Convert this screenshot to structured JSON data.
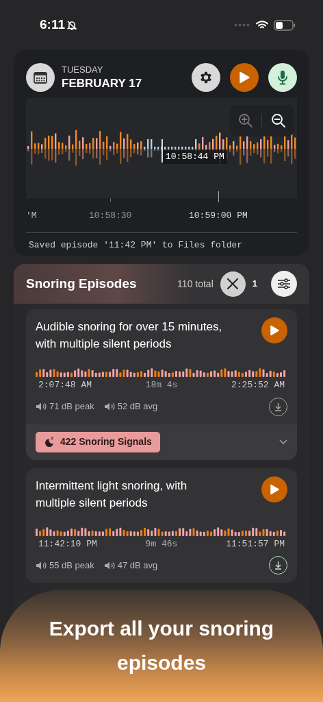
{
  "status_bar": {
    "time": "6:11",
    "silent": true
  },
  "header": {
    "weekday": "TUESDAY",
    "date": "FEBRUARY 17"
  },
  "timeline": {
    "cursor_time": "10:58:44 PM",
    "axis_labels": [
      "'M",
      "10:58:30",
      "10:59:00 PM"
    ],
    "message": "Saved episode '11:42 PM' to Files folder"
  },
  "episodes": {
    "title": "Snoring Episodes",
    "total": "110 total",
    "filter_count": "1",
    "items": [
      {
        "title": "Audible snoring for over 15 minutes, with multiple silent periods",
        "start": "2:07:48 AM",
        "duration": "18m 4s",
        "end": "2:25:52 AM",
        "peak": "71 dB peak",
        "avg": "52 dB avg",
        "exported": false,
        "signals": "422 Snoring Signals"
      },
      {
        "title": "Intermittent light snoring, with multiple silent periods",
        "start": "11:42:10 PM",
        "duration": "9m 46s",
        "end": "11:51:57 PM",
        "peak": "55 dB peak",
        "avg": "47 dB avg",
        "exported": true
      }
    ]
  },
  "banner": {
    "text": "Export all your snoring episodes"
  }
}
